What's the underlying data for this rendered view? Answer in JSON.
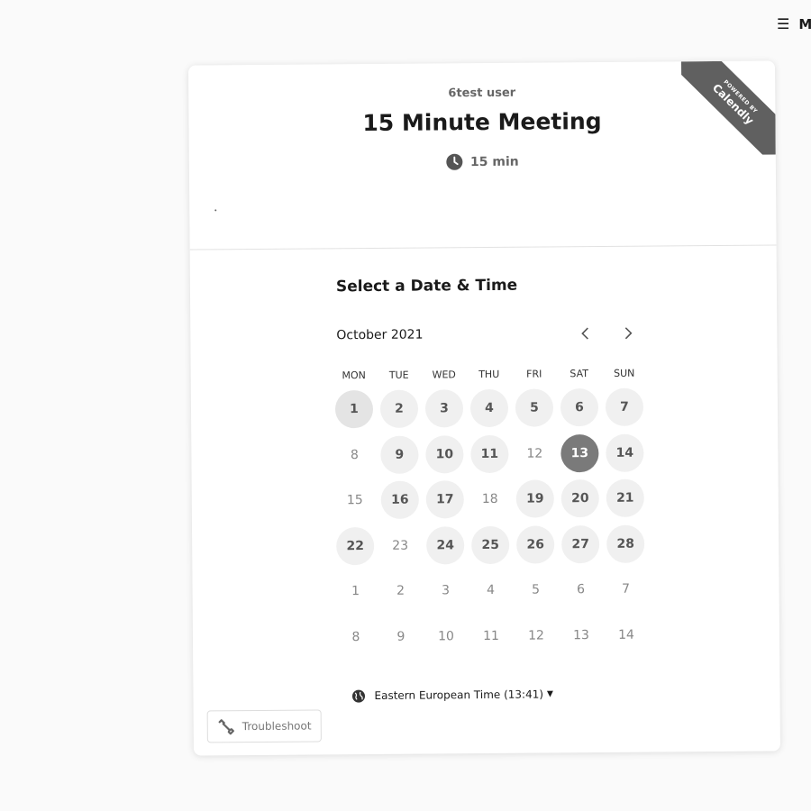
{
  "topbar": {
    "menu_label": "M"
  },
  "ribbon": {
    "small_text": "POWERED BY",
    "brand": "Calendly"
  },
  "event": {
    "owner": "6test user",
    "title": "15 Minute Meeting",
    "duration": "15 min",
    "dot_note": "."
  },
  "calendar": {
    "section_title": "Select a Date & Time",
    "month": "October 2021",
    "weekdays": [
      "MON",
      "TUE",
      "WED",
      "THU",
      "FRI",
      "SAT",
      "SUN"
    ],
    "days": [
      {
        "label": "1",
        "state": "available",
        "today": true
      },
      {
        "label": "2",
        "state": "available"
      },
      {
        "label": "3",
        "state": "available"
      },
      {
        "label": "4",
        "state": "available"
      },
      {
        "label": "5",
        "state": "available"
      },
      {
        "label": "6",
        "state": "available"
      },
      {
        "label": "7",
        "state": "available"
      },
      {
        "label": "8",
        "state": "unavailable"
      },
      {
        "label": "9",
        "state": "available"
      },
      {
        "label": "10",
        "state": "available"
      },
      {
        "label": "11",
        "state": "available"
      },
      {
        "label": "12",
        "state": "unavailable"
      },
      {
        "label": "13",
        "state": "available",
        "selected": true
      },
      {
        "label": "14",
        "state": "available"
      },
      {
        "label": "15",
        "state": "unavailable"
      },
      {
        "label": "16",
        "state": "available"
      },
      {
        "label": "17",
        "state": "available"
      },
      {
        "label": "18",
        "state": "unavailable"
      },
      {
        "label": "19",
        "state": "available"
      },
      {
        "label": "20",
        "state": "available"
      },
      {
        "label": "21",
        "state": "available"
      },
      {
        "label": "22",
        "state": "available"
      },
      {
        "label": "23",
        "state": "unavailable"
      },
      {
        "label": "24",
        "state": "available"
      },
      {
        "label": "25",
        "state": "available"
      },
      {
        "label": "26",
        "state": "available"
      },
      {
        "label": "27",
        "state": "available"
      },
      {
        "label": "28",
        "state": "available"
      },
      {
        "label": "1",
        "state": "next-month"
      },
      {
        "label": "2",
        "state": "next-month"
      },
      {
        "label": "3",
        "state": "next-month"
      },
      {
        "label": "4",
        "state": "next-month"
      },
      {
        "label": "5",
        "state": "next-month"
      },
      {
        "label": "6",
        "state": "next-month"
      },
      {
        "label": "7",
        "state": "next-month"
      },
      {
        "label": "8",
        "state": "next-month"
      },
      {
        "label": "9",
        "state": "next-month"
      },
      {
        "label": "10",
        "state": "next-month"
      },
      {
        "label": "11",
        "state": "next-month"
      },
      {
        "label": "12",
        "state": "next-month"
      },
      {
        "label": "13",
        "state": "next-month"
      },
      {
        "label": "14",
        "state": "next-month"
      }
    ]
  },
  "timezone": {
    "label": "Eastern European Time (13:41)"
  },
  "troubleshoot": {
    "label": "Troubleshoot"
  },
  "colors": {
    "selected": "#7a7a7a",
    "available_bg": "#f0f0f0",
    "ribbon": "#606060"
  }
}
